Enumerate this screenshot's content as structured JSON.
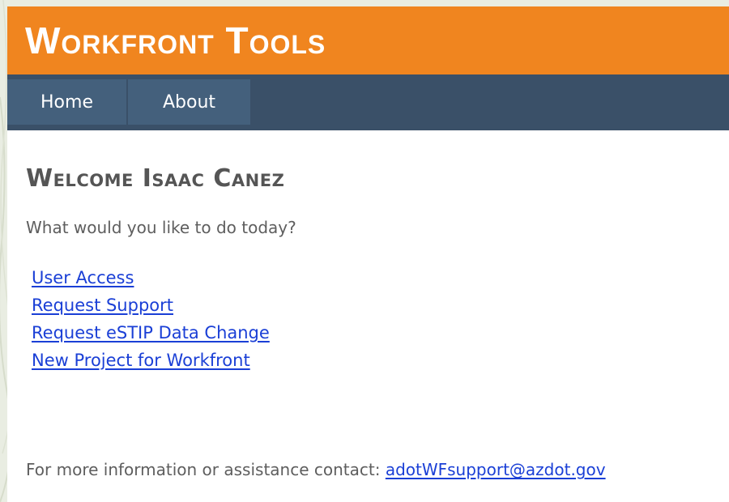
{
  "header": {
    "title": "Workfront Tools"
  },
  "nav": {
    "tabs": [
      {
        "label": "Home"
      },
      {
        "label": "About"
      }
    ]
  },
  "main": {
    "welcome": "Welcome Isaac Canez",
    "prompt": "What would you like to do today?",
    "links": [
      {
        "label": "User Access"
      },
      {
        "label": "Request Support"
      },
      {
        "label": "Request eSTIP Data Change"
      },
      {
        "label": "New Project for Workfront"
      }
    ]
  },
  "footer": {
    "contact_text": "For more information or assistance contact:",
    "contact_email": "adotWFsupport@azdot.gov"
  },
  "colors": {
    "header_bg": "#f0851f",
    "nav_bg": "#3a5068",
    "tab_bg": "#44607c",
    "link": "#1a3fd6"
  }
}
